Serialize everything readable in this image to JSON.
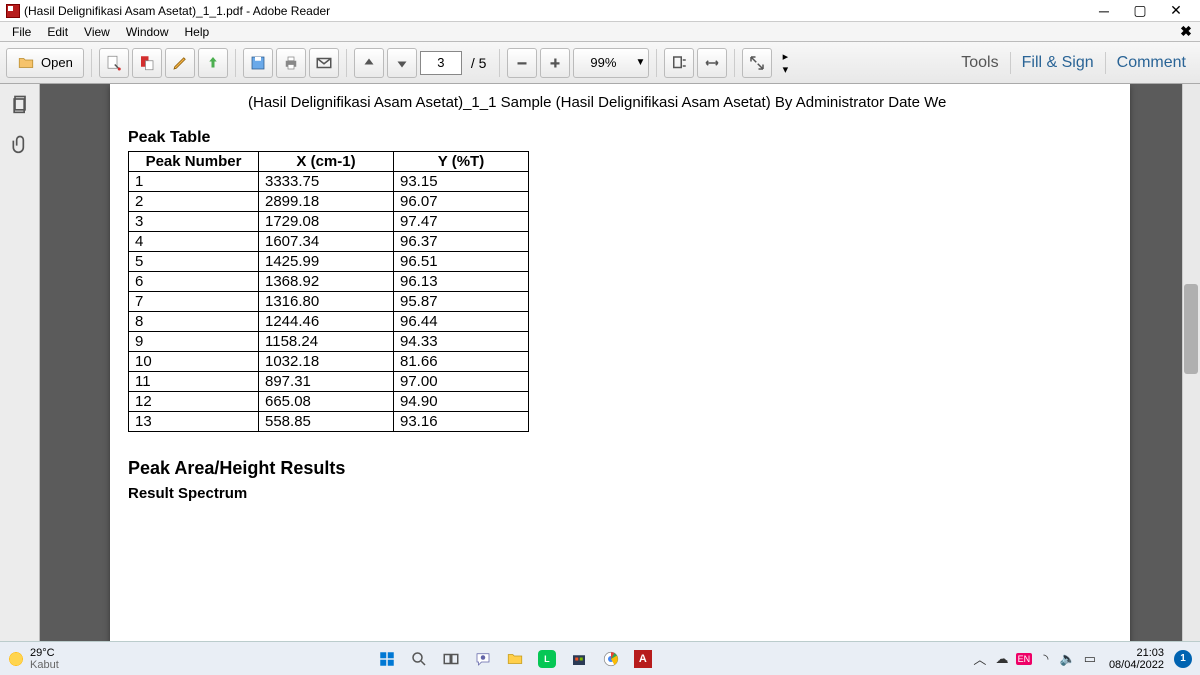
{
  "window": {
    "title": "(Hasil Delignifikasi Asam Asetat)_1_1.pdf - Adobe Reader"
  },
  "menu": {
    "file": "File",
    "edit": "Edit",
    "view": "View",
    "window": "Window",
    "help": "Help"
  },
  "toolbar": {
    "open": "Open",
    "page_current": "3",
    "page_total": "/ 5",
    "zoom": "99%",
    "tools": "Tools",
    "fillsign": "Fill & Sign",
    "comment": "Comment"
  },
  "doc": {
    "header": "(Hasil Delignifikasi Asam Asetat)_1_1    Sample (Hasil Delignifikasi Asam Asetat) By Administrator Date We",
    "peak_table_title": "Peak Table",
    "columns": {
      "c1": "Peak Number",
      "c2": "X (cm-1)",
      "c3": "Y (%T)"
    },
    "rows": [
      {
        "n": "1",
        "x": "3333.75",
        "y": "93.15"
      },
      {
        "n": "2",
        "x": "2899.18",
        "y": "96.07"
      },
      {
        "n": "3",
        "x": "1729.08",
        "y": "97.47"
      },
      {
        "n": "4",
        "x": "1607.34",
        "y": "96.37"
      },
      {
        "n": "5",
        "x": "1425.99",
        "y": "96.51"
      },
      {
        "n": "6",
        "x": "1368.92",
        "y": "96.13"
      },
      {
        "n": "7",
        "x": "1316.80",
        "y": "95.87"
      },
      {
        "n": "8",
        "x": "1244.46",
        "y": "96.44"
      },
      {
        "n": "9",
        "x": "1158.24",
        "y": "94.33"
      },
      {
        "n": "10",
        "x": "1032.18",
        "y": "81.66"
      },
      {
        "n": "11",
        "x": "897.31",
        "y": "97.00"
      },
      {
        "n": "12",
        "x": "665.08",
        "y": "94.90"
      },
      {
        "n": "13",
        "x": "558.85",
        "y": "93.16"
      }
    ],
    "section2_title": "Peak Area/Height Results",
    "section2_sub": "Result Spectrum"
  },
  "taskbar": {
    "temp": "29°C",
    "condition": "Kabut",
    "time": "21:03",
    "date": "08/04/2022",
    "badge": "1"
  }
}
